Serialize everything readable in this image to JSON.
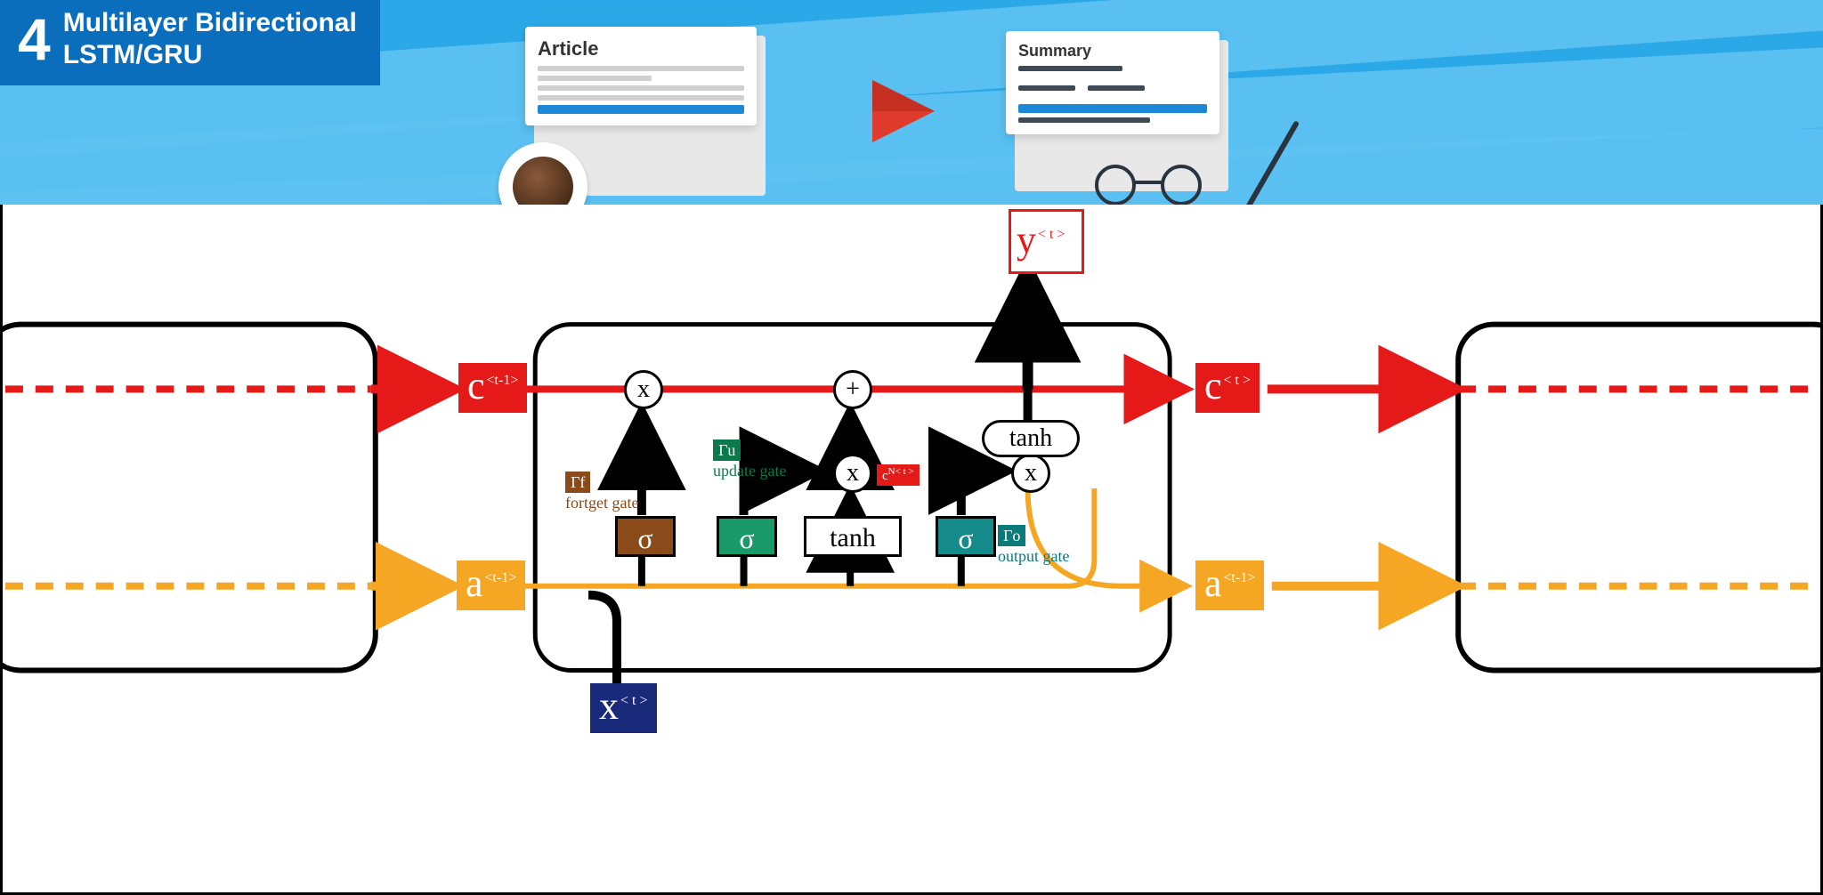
{
  "header": {
    "number": "4",
    "title": "Multilayer Bidirectional\nLSTM/GRU",
    "article_label": "Article",
    "summary_label": "Summary"
  },
  "diagram": {
    "output": {
      "name": "y",
      "sup": "< t >"
    },
    "cell_state_in": {
      "name": "c",
      "sup": "<t-1>"
    },
    "cell_state_out": {
      "name": "c",
      "sup": "< t >"
    },
    "hidden_in": {
      "name": "a",
      "sup": "<t-1>"
    },
    "hidden_out": {
      "name": "a",
      "sup": "<t-1>"
    },
    "input": {
      "name": "x",
      "sup": "< t >"
    },
    "candidate": {
      "name": "c",
      "sup": "N< t >"
    },
    "gates": {
      "forget": {
        "symbol": "Γf",
        "desc": "fortget\ngate"
      },
      "update": {
        "symbol": "Γu",
        "desc": "update\ngate"
      },
      "output": {
        "symbol": "Γo",
        "desc": "output\ngate"
      }
    },
    "ops": {
      "sigma": "σ",
      "tanh": "tanh",
      "mult": "x",
      "add": "+"
    }
  }
}
